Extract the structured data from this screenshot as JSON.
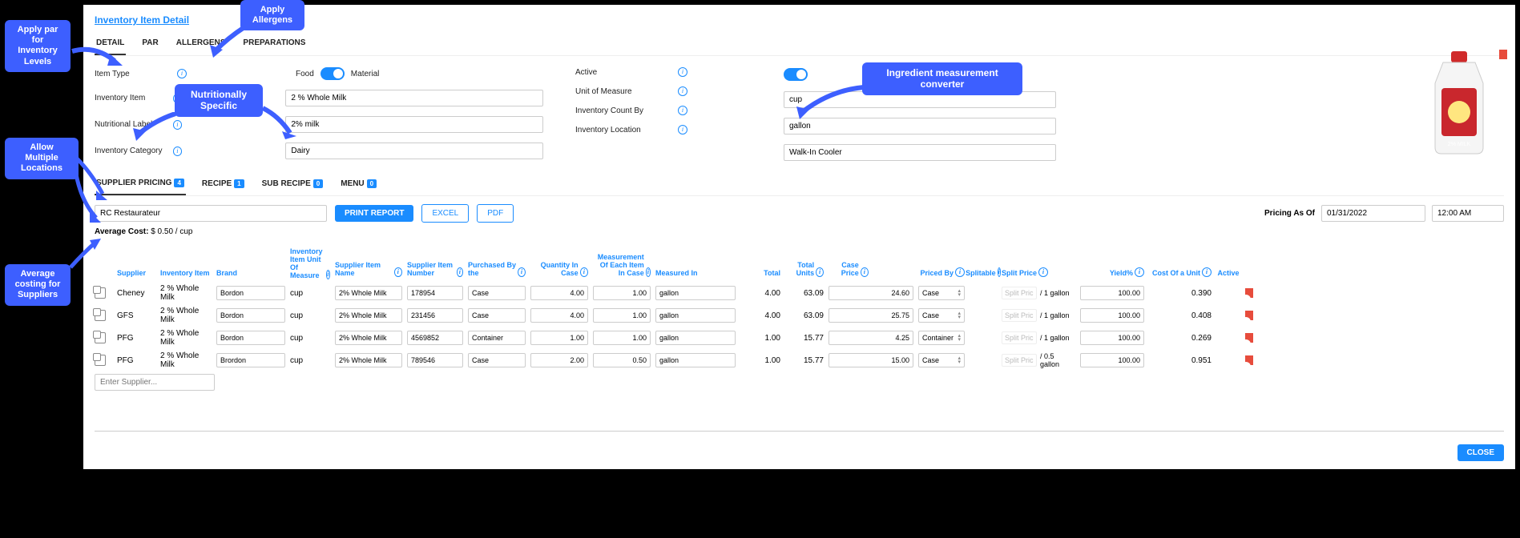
{
  "breadcrumb": "Inventory Item Detail",
  "tabs": [
    "DETAIL",
    "PAR",
    "ALLERGENS",
    "PREPARATIONS"
  ],
  "active_tab": 0,
  "detail": {
    "item_type_label": "Item Type",
    "food_label": "Food",
    "material_label": "Material",
    "inventory_item_label": "Inventory Item",
    "inventory_item_value": "2 % Whole Milk",
    "nutritional_label_label": "Nutritional Label",
    "nutritional_label_value": "2% milk",
    "inventory_category_label": "Inventory Category",
    "inventory_category_value": "Dairy",
    "active_label": "Active",
    "uom_label": "Unit of Measure",
    "uom_value": "cup",
    "count_by_label": "Inventory Count By",
    "count_by_value": "gallon",
    "location_label": "Inventory Location",
    "location_value": "Walk-In Cooler"
  },
  "subtabs": [
    {
      "label": "SUPPLIER PRICING",
      "badge": "4"
    },
    {
      "label": "RECIPE",
      "badge": "1"
    },
    {
      "label": "SUB RECIPE",
      "badge": "0"
    },
    {
      "label": "MENU",
      "badge": "0"
    }
  ],
  "active_subtab": 0,
  "restaurateur_value": "RC Restaurateur",
  "buttons": {
    "print": "PRINT REPORT",
    "excel": "EXCEL",
    "pdf": "PDF"
  },
  "pricing_as_of_label": "Pricing As Of",
  "pricing_date": "01/31/2022",
  "pricing_time": "12:00 AM",
  "avg_cost_label": "Average Cost:",
  "avg_cost_value": "$ 0.50 / cup",
  "headers": {
    "supplier": "Supplier",
    "inventory_item": "Inventory Item",
    "brand": "Brand",
    "uom": "Inventory Item Unit Of Measure",
    "sup_item_name": "Supplier Item Name",
    "sup_item_num": "Supplier Item Number",
    "purchased_by": "Purchased By the",
    "qty_in_case": "Quantity In Case",
    "meas_each": "Measurement Of Each Item In Case",
    "measured_in": "Measured In",
    "total": "Total",
    "total_units": "Total Units",
    "case_price": "Case Price",
    "priced_by": "Priced By",
    "splitable": "Splitable",
    "split_price": "Split Price",
    "yield": "Yield%",
    "cost_unit": "Cost Of a Unit",
    "active": "Active"
  },
  "split_placeholder": "Split Pric",
  "rows": [
    {
      "supplier": "Cheney",
      "item": "2 % Whole Milk",
      "brand": "Bordon",
      "uom": "cup",
      "sname": "2% Whole Milk",
      "snum": "178954",
      "pby": "Case",
      "qty": "4.00",
      "meas": "1.00",
      "min": "gallon",
      "total": "4.00",
      "tunits": "63.09",
      "cprice": "24.60",
      "priced": "Case",
      "split_per": "/ 1 gallon",
      "yield": "100.00",
      "cost": "0.390"
    },
    {
      "supplier": "GFS",
      "item": "2 % Whole Milk",
      "brand": "Bordon",
      "uom": "cup",
      "sname": "2% Whole Milk",
      "snum": "231456",
      "pby": "Case",
      "qty": "4.00",
      "meas": "1.00",
      "min": "gallon",
      "total": "4.00",
      "tunits": "63.09",
      "cprice": "25.75",
      "priced": "Case",
      "split_per": "/ 1 gallon",
      "yield": "100.00",
      "cost": "0.408"
    },
    {
      "supplier": "PFG",
      "item": "2 % Whole Milk",
      "brand": "Bordon",
      "uom": "cup",
      "sname": "2% Whole Milk",
      "snum": "4569852",
      "pby": "Container",
      "qty": "1.00",
      "meas": "1.00",
      "min": "gallon",
      "total": "1.00",
      "tunits": "15.77",
      "cprice": "4.25",
      "priced": "Container",
      "split_per": "/ 1 gallon",
      "yield": "100.00",
      "cost": "0.269"
    },
    {
      "supplier": "PFG",
      "item": "2 % Whole Milk",
      "brand": "Brordon",
      "uom": "cup",
      "sname": "2% Whole Milk",
      "snum": "789546",
      "pby": "Case",
      "qty": "2.00",
      "meas": "0.50",
      "min": "gallon",
      "total": "1.00",
      "tunits": "15.77",
      "cprice": "15.00",
      "priced": "Case",
      "split_per": "/ 0.5 gallon",
      "yield": "100.00",
      "cost": "0.951"
    }
  ],
  "enter_supplier_placeholder": "Enter Supplier...",
  "close_label": "CLOSE",
  "callouts": {
    "par": "Apply par for Inventory Levels",
    "allergens": "Apply Allergens",
    "nutrition": "Nutritionally Specific",
    "measurement": "Ingredient measurement converter",
    "locations": "Allow Multiple Locations",
    "avgcost": "Average costing for Suppliers"
  }
}
